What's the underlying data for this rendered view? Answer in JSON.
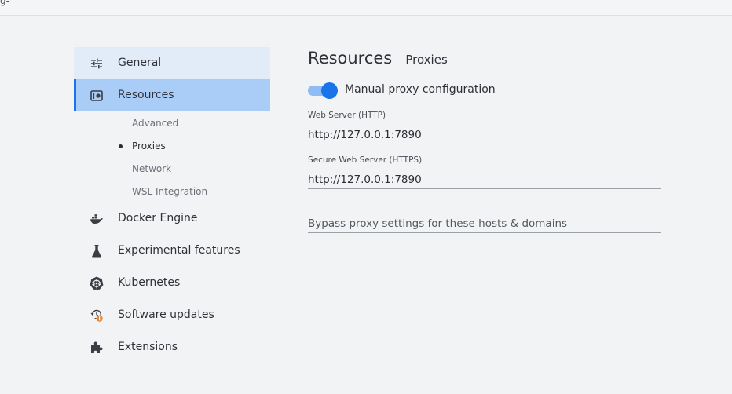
{
  "topbar": {
    "fragment": "g-"
  },
  "sidebar": {
    "items": [
      {
        "label": "General",
        "icon": "sliders-icon"
      },
      {
        "label": "Resources",
        "icon": "resources-icon"
      },
      {
        "label": "Docker Engine",
        "icon": "whale-icon"
      },
      {
        "label": "Experimental features",
        "icon": "flask-icon"
      },
      {
        "label": "Kubernetes",
        "icon": "helm-wheel-icon"
      },
      {
        "label": "Software updates",
        "icon": "update-clock-icon",
        "badge": "!"
      },
      {
        "label": "Extensions",
        "icon": "puzzle-icon"
      }
    ],
    "resources_sub": [
      {
        "label": "Advanced"
      },
      {
        "label": "Proxies",
        "selected": true
      },
      {
        "label": "Network"
      },
      {
        "label": "WSL Integration"
      }
    ]
  },
  "main": {
    "title": "Resources",
    "subtitle": "Proxies",
    "manual_proxy": {
      "label": "Manual proxy configuration",
      "enabled": true
    },
    "web_server": {
      "label": "Web Server (HTTP)",
      "value": "http://127.0.0.1:7890"
    },
    "secure_web_server": {
      "label": "Secure Web Server (HTTPS)",
      "value": "http://127.0.0.1:7890"
    },
    "bypass": {
      "placeholder": "Bypass proxy settings for these hosts & domains",
      "value": ""
    }
  },
  "colors": {
    "accent": "#1a73e8",
    "active_bg": "#a9cdf7",
    "hover_bg": "#e2ecf8",
    "badge": "#e8893a"
  }
}
